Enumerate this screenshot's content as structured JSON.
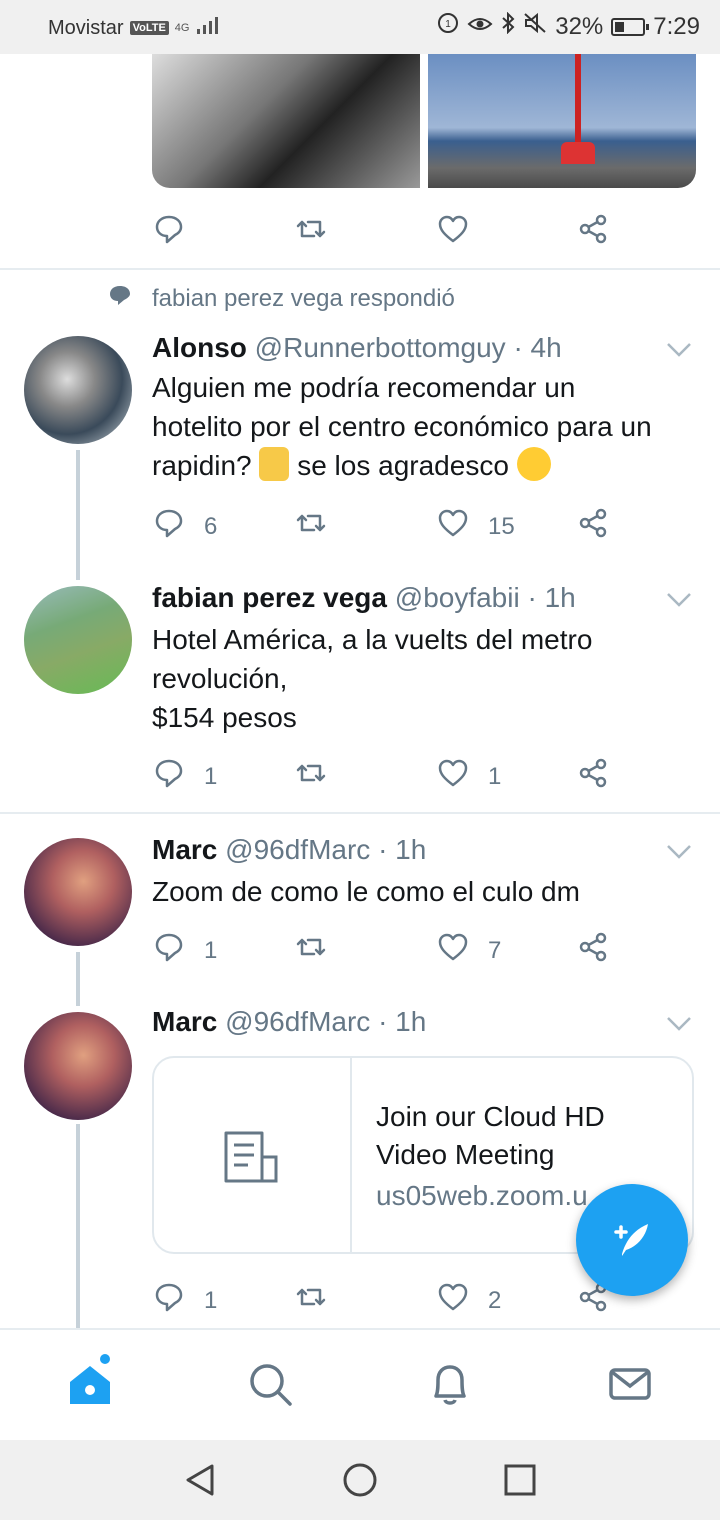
{
  "status_bar": {
    "carrier": "Movistar",
    "volte": "VoLTE",
    "network": "4G",
    "battery": "32%",
    "battery_level": 0.32,
    "time": "7:29"
  },
  "top_tweet_actions": {
    "reply": "",
    "retweet": "",
    "like": ""
  },
  "context_line": "fabian perez vega respondió",
  "tweets": [
    {
      "name": "Alonso",
      "handle": "@Runnerbottomguy · 4h",
      "text_line1": "Alguien me podría recomendar un",
      "text_line2": "hotelito por el centro económico para un",
      "text_line3a": "rapidin?",
      "text_line3b": "se los agradesco",
      "replies": "6",
      "retweets": "",
      "likes": "15"
    },
    {
      "name": "fabian perez vega",
      "handle": "@boyfabii · 1h",
      "text_line1": "Hotel América, a la vuelts del metro",
      "text_line2": "revolución,",
      "text_line3": "$154 pesos",
      "replies": "1",
      "retweets": "",
      "likes": "1"
    },
    {
      "name": "Marc",
      "handle": "@96dfMarc · 1h",
      "text_line1": "Zoom de como le como el culo dm",
      "replies": "1",
      "retweets": "",
      "likes": "7"
    },
    {
      "name": "Marc",
      "handle": "@96dfMarc · 1h",
      "card_title": "Join our Cloud HD Video Meeting",
      "card_url": "us05web.zoom.u",
      "replies": "1",
      "retweets": "",
      "likes": "2"
    }
  ],
  "colors": {
    "accent": "#1da1f2",
    "secondary_text": "#657786",
    "divider": "#e6ecf0"
  },
  "icons": [
    "reply-icon",
    "retweet-icon",
    "like-icon",
    "share-icon",
    "home-icon",
    "search-icon",
    "notifications-icon",
    "messages-icon",
    "compose-icon"
  ]
}
